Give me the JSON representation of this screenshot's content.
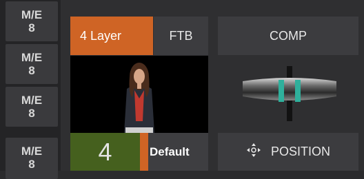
{
  "sidebar": {
    "items": [
      {
        "line1": "M/E",
        "line2": "8"
      },
      {
        "line1": "M/E",
        "line2": "8"
      },
      {
        "line1": "M/E",
        "line2": "8"
      },
      {
        "line1": "M/E",
        "line2": "8"
      }
    ]
  },
  "layer": {
    "layer_button_label": "4 Layer",
    "ftb_label": "FTB",
    "input_number": "4",
    "preset_label": "Default"
  },
  "transition": {
    "comp_label": "COMP",
    "position_label": "POSITION",
    "position_icon": "move-arrows-icon"
  },
  "colors": {
    "accent_orange": "#cf6425",
    "number_green": "#45601e",
    "tbar_teal": "#2fb09c"
  }
}
